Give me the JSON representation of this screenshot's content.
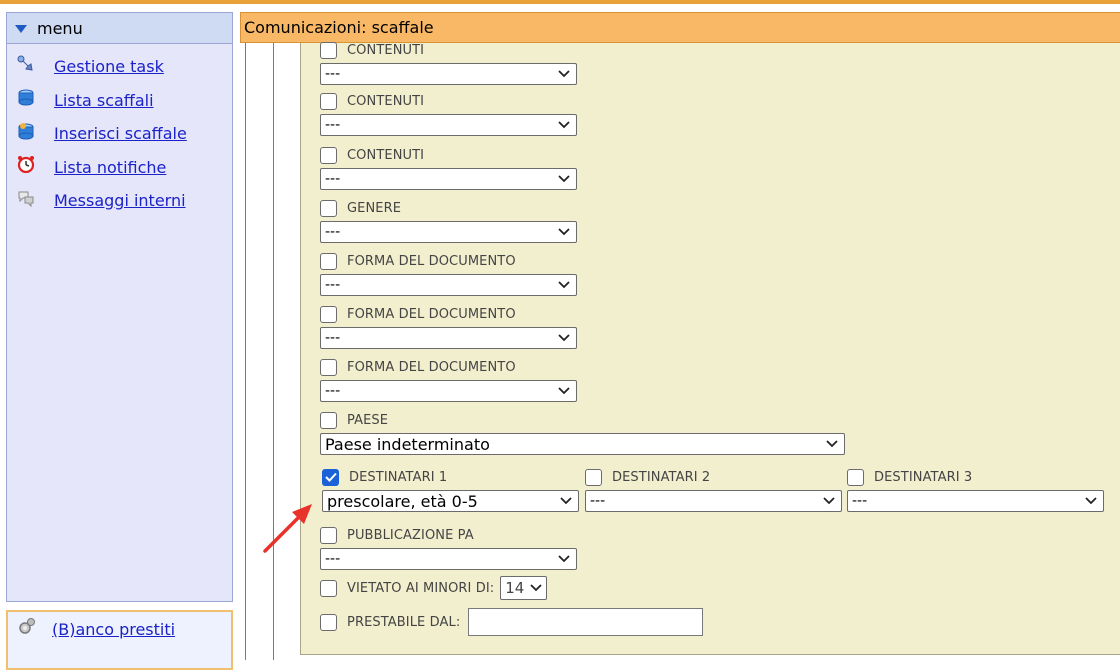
{
  "sidebar": {
    "header_label": "menu",
    "items": [
      {
        "label": "Gestione task",
        "icon": "pin-icon"
      },
      {
        "label": "Lista scaffali",
        "icon": "shelf-icon"
      },
      {
        "label": "Inserisci scaffale",
        "icon": "add-shelf-icon"
      },
      {
        "label": "Lista notifiche",
        "icon": "alarm-clock-icon"
      },
      {
        "label": "Messaggi interni",
        "icon": "messages-icon"
      }
    ],
    "bottom_items": [
      {
        "label": "(B)anco prestiti",
        "icon": "gear-icon"
      }
    ]
  },
  "main": {
    "title": "Comunicazioni: scaffale",
    "fields": [
      {
        "label": "CONTENUTI",
        "value": "---",
        "checked": false
      },
      {
        "label": "CONTENUTI",
        "value": "---",
        "checked": false
      },
      {
        "label": "CONTENUTI",
        "value": "---",
        "checked": false
      },
      {
        "label": "GENERE",
        "value": "---",
        "checked": false
      },
      {
        "label": "FORMA DEL DOCUMENTO",
        "value": "---",
        "checked": false
      },
      {
        "label": "FORMA DEL DOCUMENTO",
        "value": "---",
        "checked": false
      },
      {
        "label": "FORMA DEL DOCUMENTO",
        "value": "---",
        "checked": false
      },
      {
        "label": "PAESE",
        "value": "Paese indeterminato",
        "checked": false
      }
    ],
    "destinatari": [
      {
        "label": "DESTINATARI 1",
        "value": "prescolare, età 0-5",
        "checked": true
      },
      {
        "label": "DESTINATARI 2",
        "value": "---",
        "checked": false
      },
      {
        "label": "DESTINATARI 3",
        "value": "---",
        "checked": false
      }
    ],
    "pubblicazione": {
      "label": "PUBBLICAZIONE PA",
      "value": "---",
      "checked": false
    },
    "vietato": {
      "label": "VIETATO AI MINORI DI:",
      "value": "14",
      "checked": false
    },
    "prestabile": {
      "label": "PRESTABILE DAL:",
      "value": "",
      "checked": false
    }
  },
  "colors": {
    "accent_header": "#f8b866",
    "form_bg": "#f2efcf",
    "sidebar_bg": "#e6e6fb",
    "link": "#1a22c8",
    "checkbox_checked": "#1a62d6",
    "annotation_arrow": "#e8322a"
  }
}
